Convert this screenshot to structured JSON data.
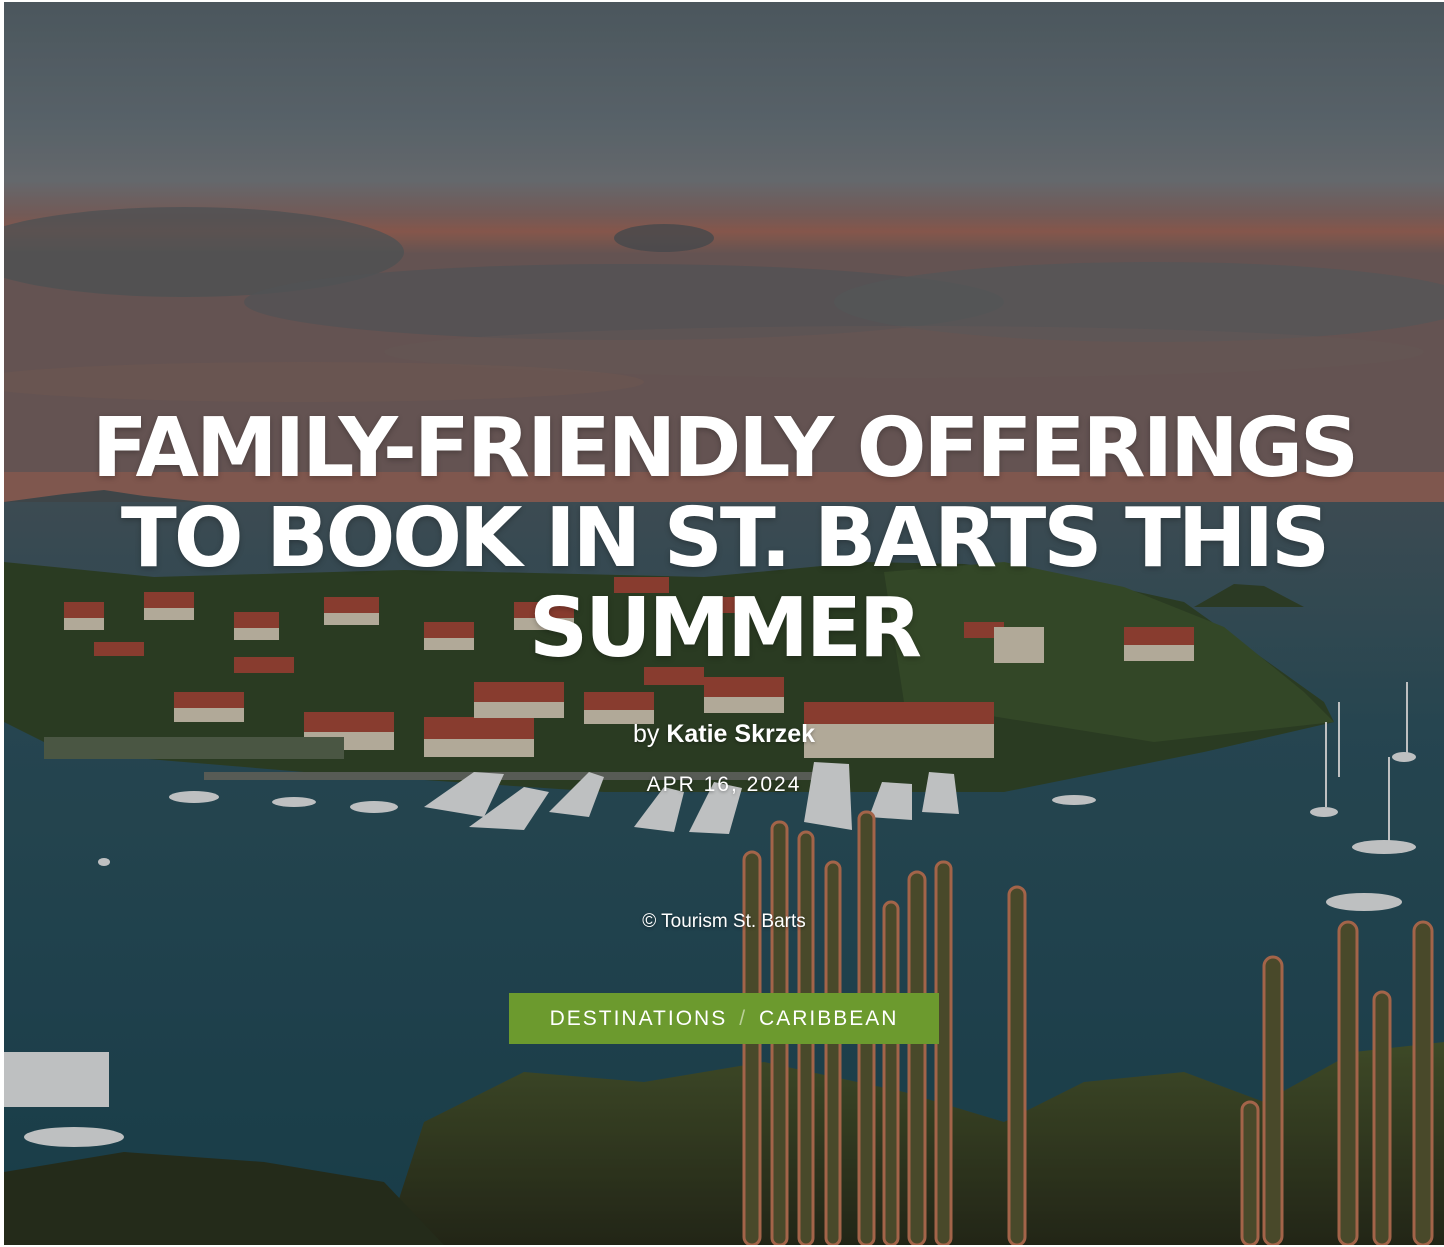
{
  "article": {
    "title": "FAMILY-FRIENDLY OFFERINGS TO BOOK IN ST. BARTS THIS SUMMER",
    "byline_prefix": "by",
    "author": "Katie Skrzek",
    "date": "APR 16, 2024",
    "image_credit": "© Tourism St. Barts"
  },
  "categories": {
    "primary": "DESTINATIONS",
    "separator": "/",
    "secondary": "CARIBBEAN"
  },
  "colors": {
    "category_badge": "#6c9a2e",
    "text": "#ffffff"
  }
}
